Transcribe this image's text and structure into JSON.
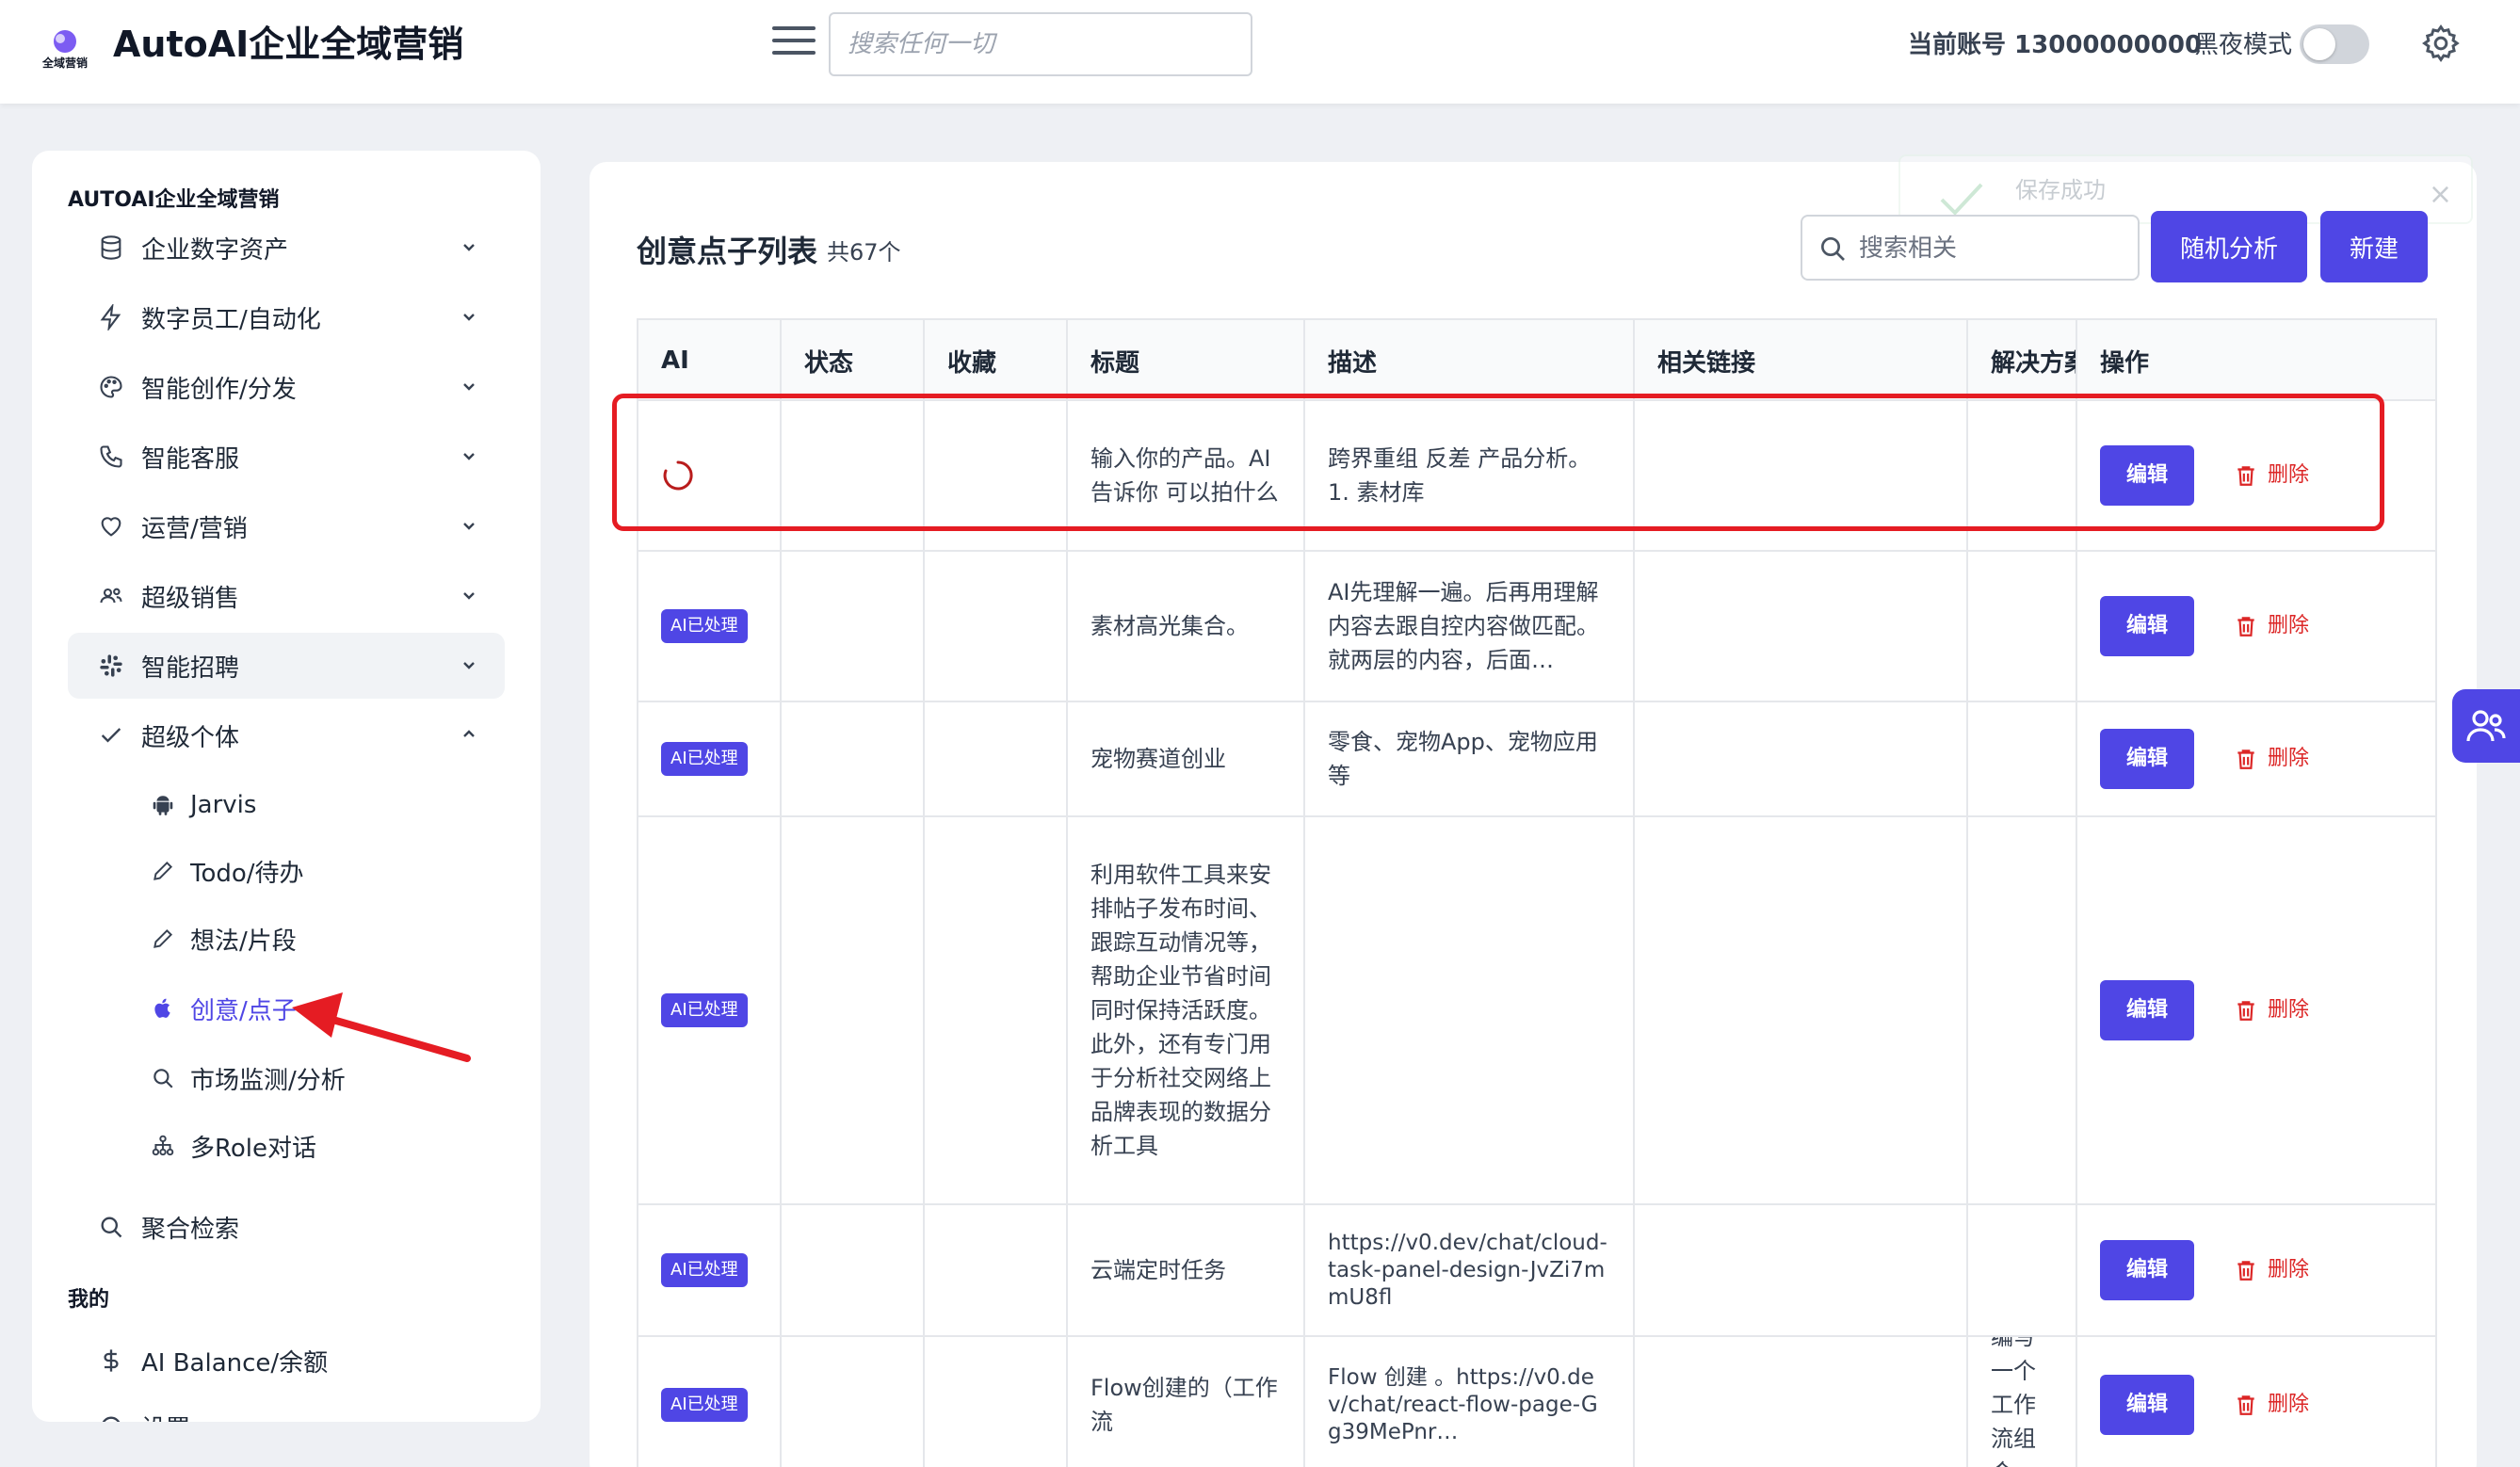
{
  "header": {
    "logo_text": "全域营销",
    "app_title": "AutoAI企业全域营销",
    "search_placeholder": "搜索任何一切",
    "account_label": "当前账号 13000000000",
    "dark_mode_label": "黑夜模式",
    "dark_mode_on": false
  },
  "sidebar": {
    "section_main": "AUTOAI企业全域营销",
    "items": [
      {
        "label": "企业数字资产",
        "icon": "database-icon"
      },
      {
        "label": "数字员工/自动化",
        "icon": "lightning-icon"
      },
      {
        "label": "智能创作/分发",
        "icon": "palette-icon"
      },
      {
        "label": "智能客服",
        "icon": "phone-icon"
      },
      {
        "label": "运营/营销",
        "icon": "heart-icon"
      },
      {
        "label": "超级销售",
        "icon": "users-icon"
      },
      {
        "label": "智能招聘",
        "icon": "slack-icon"
      },
      {
        "label": "超级个体",
        "icon": "check-icon"
      }
    ],
    "sub_items": [
      {
        "label": "Jarvis",
        "icon": "android-icon"
      },
      {
        "label": "Todo/待办",
        "icon": "pencil-icon"
      },
      {
        "label": "想法/片段",
        "icon": "pencil-icon"
      },
      {
        "label": "创意/点子",
        "icon": "apple-icon"
      },
      {
        "label": "市场监测/分析",
        "icon": "search-icon"
      },
      {
        "label": "多Role对话",
        "icon": "hierarchy-icon"
      }
    ],
    "aggregate_search": "聚合检索",
    "section_mine": "我的",
    "balance": "AI Balance/余额",
    "partial_item": "设置"
  },
  "main": {
    "toast_text": "保存成功",
    "list_title": "创意点子列表",
    "list_count": "共67个",
    "search_placeholder": "搜索相关",
    "random_button": "随机分析",
    "new_button": "新建",
    "columns": [
      "AI",
      "状态",
      "收藏",
      "标题",
      "描述",
      "相关链接",
      "解决方案",
      "操作"
    ],
    "edit_label": "编辑",
    "delete_label": "删除",
    "badge_label": "AI已处理",
    "rows": [
      {
        "title": "输入你的产品。AI告诉你 可以拍什么",
        "desc": "跨界重组 反差 产品分析。1. 素材库",
        "solution": "",
        "loading": true
      },
      {
        "title": "素材高光集合。",
        "desc": "AI先理解一遍。后再用理解内容去跟自控内容做匹配。就两层的内容，后面…",
        "solution": ""
      },
      {
        "title": "宠物赛道创业",
        "desc": "零食、宠物App、宠物应用等",
        "solution": ""
      },
      {
        "title": "利用软件工具来安排帖子发布时间、跟踪互动情况等，帮助企业节省时间同时保持活跃度。此外，还有专门用于分析社交网络上品牌表现的数据分析工具",
        "desc": "",
        "solution": ""
      },
      {
        "title": "云端定时任务",
        "desc": "https://v0.dev/chat/cloud-task-panel-design-JvZi7mmU8fl",
        "solution": ""
      },
      {
        "title": "Flow创建的（工作流",
        "desc": "Flow 创建 。https://v0.dev/chat/react-flow-page-Gg39MePnr…",
        "solution": "编写一个工作流组合"
      }
    ]
  },
  "colors": {
    "accent": "#4f46e5",
    "danger": "#dc2626",
    "annotation": "#e51c23"
  }
}
